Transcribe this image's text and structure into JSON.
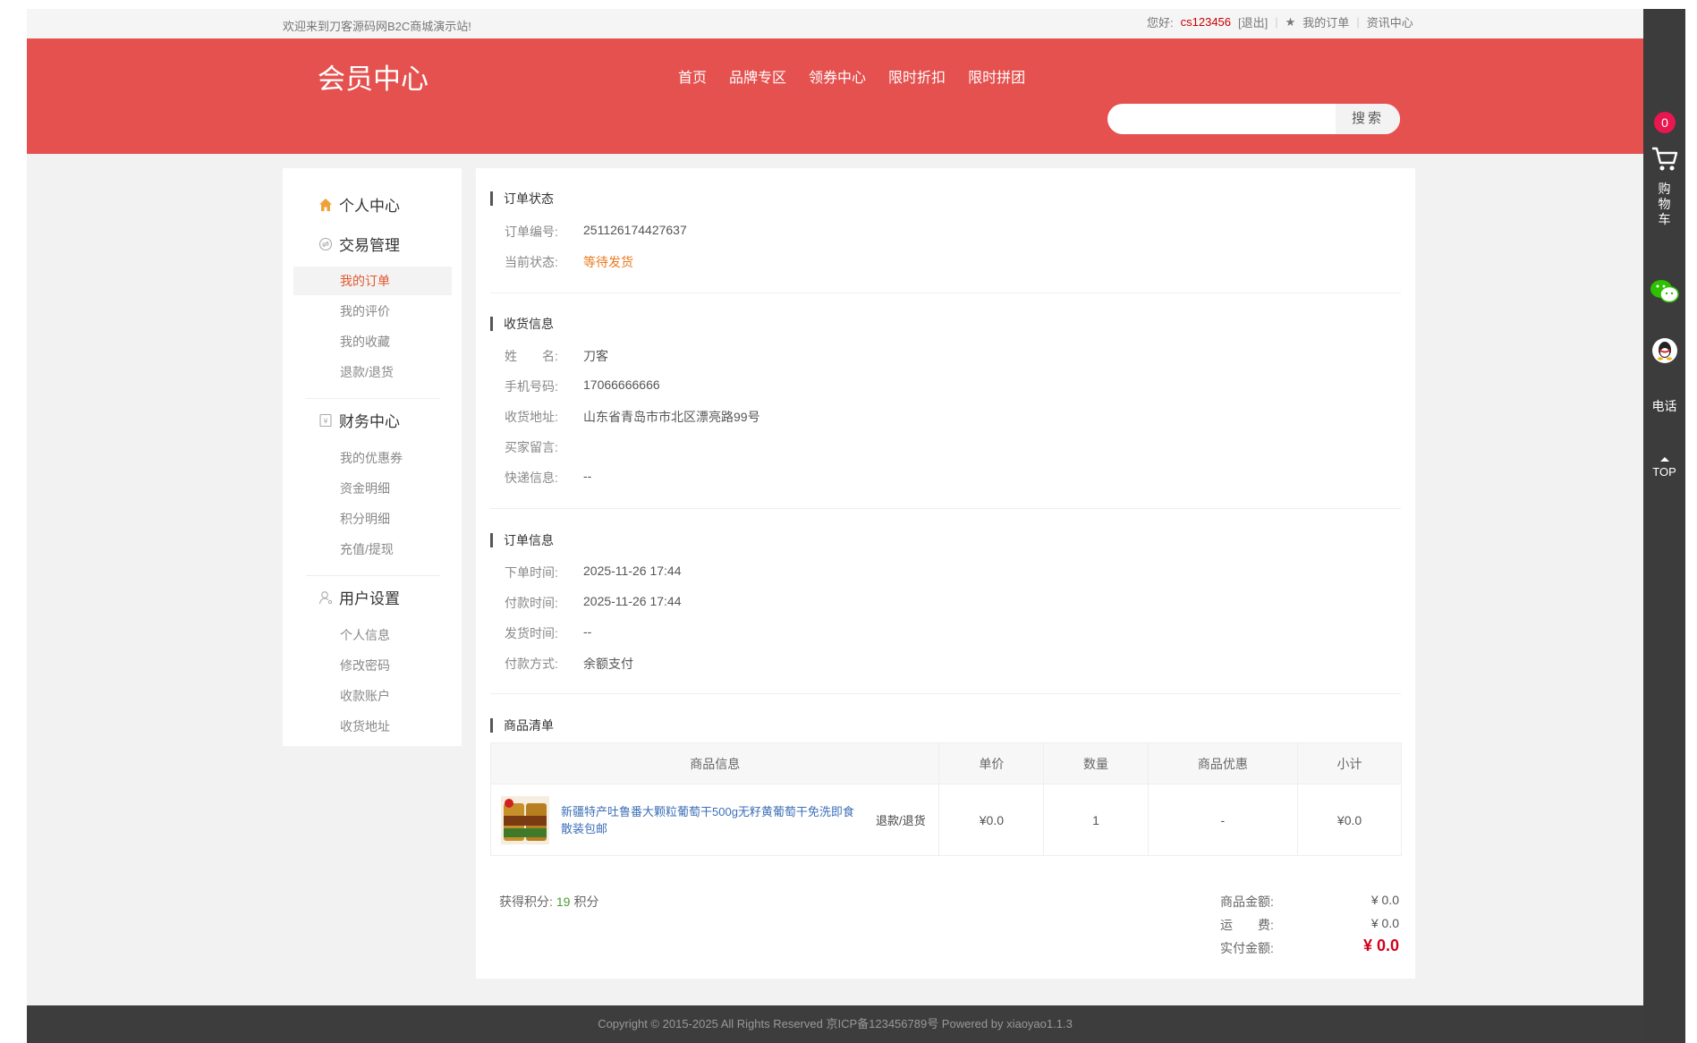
{
  "topbar": {
    "welcome": "欢迎来到刀客源码网B2C商城演示站!",
    "hello_label": "您好:",
    "username": "cs123456",
    "logout": "[退出]",
    "my_orders": "我的订单",
    "news": "资讯中心"
  },
  "header": {
    "brand": "会员中心",
    "nav": [
      "首页",
      "品牌专区",
      "领券中心",
      "限时折扣",
      "限时拼团"
    ],
    "search_placeholder": "",
    "search_button": "搜索"
  },
  "sidebar": {
    "personal": "个人中心",
    "trade": {
      "title": "交易管理",
      "items": [
        "我的订单",
        "我的评价",
        "我的收藏",
        "退款/退货"
      ]
    },
    "finance": {
      "title": "财务中心",
      "items": [
        "我的优惠券",
        "资金明细",
        "积分明细",
        "充值/提现"
      ]
    },
    "settings": {
      "title": "用户设置",
      "items": [
        "个人信息",
        "修改密码",
        "收款账户",
        "收货地址"
      ]
    }
  },
  "order_status": {
    "title": "订单状态",
    "order_no_label": "订单编号:",
    "order_no": "251126174427637",
    "status_label": "当前状态:",
    "status": "等待发货"
  },
  "shipping": {
    "title": "收货信息",
    "name_label": "姓　　名:",
    "name": "刀客",
    "phone_label": "手机号码:",
    "phone": "17066666666",
    "address_label": "收货地址:",
    "address": "山东省青岛市市北区漂亮路99号",
    "message_label": "买家留言:",
    "message": "",
    "express_label": "快递信息:",
    "express": "--"
  },
  "order_info": {
    "title": "订单信息",
    "order_time_label": "下单时间:",
    "order_time": "2025-11-26 17:44",
    "pay_time_label": "付款时间:",
    "pay_time": "2025-11-26 17:44",
    "ship_time_label": "发货时间:",
    "ship_time": "--",
    "pay_method_label": "付款方式:",
    "pay_method": "余额支付"
  },
  "goods": {
    "title": "商品清单",
    "headers": [
      "商品信息",
      "单价",
      "数量",
      "商品优惠",
      "小计"
    ],
    "rows": [
      {
        "name": "新疆特产吐鲁番大颗粒葡萄干500g无籽黄葡萄干免洗即食散装包邮",
        "refund": "退款/退货",
        "price": "¥0.0",
        "qty": "1",
        "discount": "-",
        "subtotal": "¥0.0"
      }
    ]
  },
  "summary": {
    "points_label": "获得积分:",
    "points": "19",
    "points_unit": "积分",
    "goods_amount_label": "商品金额:",
    "goods_amount": "¥ 0.0",
    "freight_label": "运　　费:",
    "freight": "¥ 0.0",
    "paid_label": "实付金额:",
    "paid": "¥ 0.0"
  },
  "footer": {
    "text": "Copyright © 2015-2025 All Rights Reserved 京ICP备123456789号   Powered by xiaoyao1.1.3"
  },
  "dock": {
    "cart_count": "0",
    "cart_label": "购\n物\n车",
    "phone_label": "电话",
    "top_label": "TOP"
  },
  "colors": {
    "brand_red": "#e4514f",
    "active_orange": "#e4572e",
    "status_orange": "#e87b1e",
    "price_red": "#d0021b",
    "badge_pink": "#e8174f"
  }
}
